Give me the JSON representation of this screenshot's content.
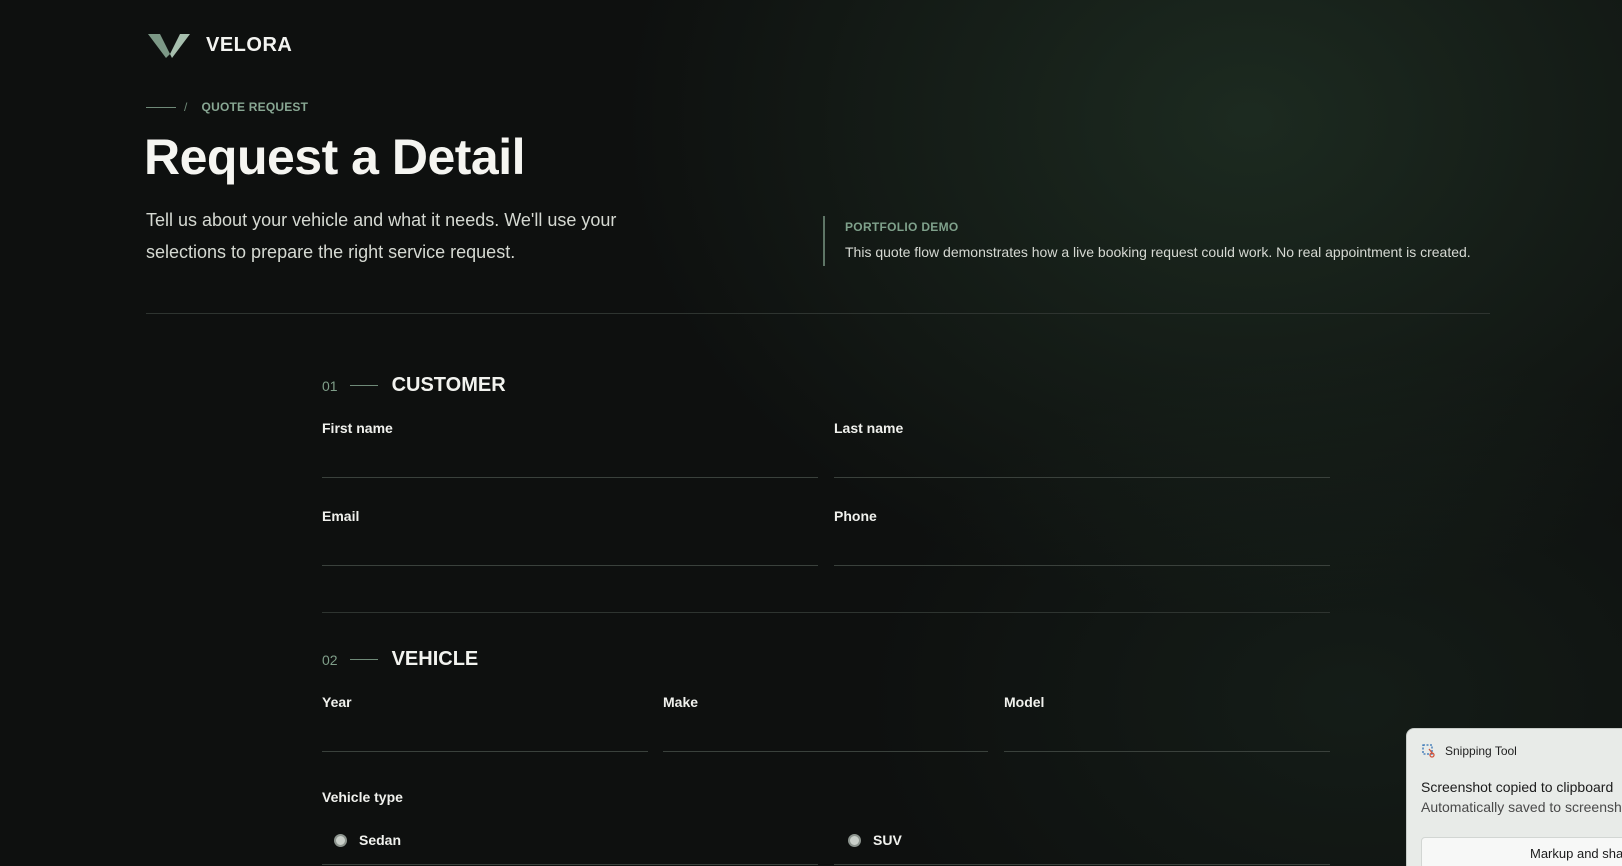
{
  "brand": {
    "name": "VELORA",
    "logo": "velora-v-logo"
  },
  "breadcrumb": {
    "label": "QUOTE REQUEST"
  },
  "hero": {
    "title": "Request a Detail",
    "intro": "Tell us about your vehicle and what it needs. We'll use your selections to prepare the right service request."
  },
  "notice": {
    "label": "PORTFOLIO DEMO",
    "text": "This quote flow demonstrates how a live booking request could work. No real appointment is created."
  },
  "sections": {
    "customer": {
      "number": "01",
      "title": "CUSTOMER",
      "fields": {
        "first_name": {
          "label": "First name",
          "value": ""
        },
        "last_name": {
          "label": "Last name",
          "value": ""
        },
        "email": {
          "label": "Email",
          "value": ""
        },
        "phone": {
          "label": "Phone",
          "value": ""
        }
      }
    },
    "vehicle": {
      "number": "02",
      "title": "VEHICLE",
      "fields": {
        "year": {
          "label": "Year",
          "value": ""
        },
        "make": {
          "label": "Make",
          "value": ""
        },
        "model": {
          "label": "Model",
          "value": ""
        }
      },
      "vehicle_type": {
        "label": "Vehicle type",
        "options": [
          "Sedan",
          "SUV"
        ]
      }
    }
  },
  "toast": {
    "app": "Snipping Tool",
    "title": "Screenshot copied to clipboard",
    "subtitle": "Automatically saved to screenshots folder",
    "button": "Markup and share"
  },
  "colors": {
    "accent": "#7fa18b",
    "background": "#0e100f",
    "text": "#eef0ec"
  }
}
